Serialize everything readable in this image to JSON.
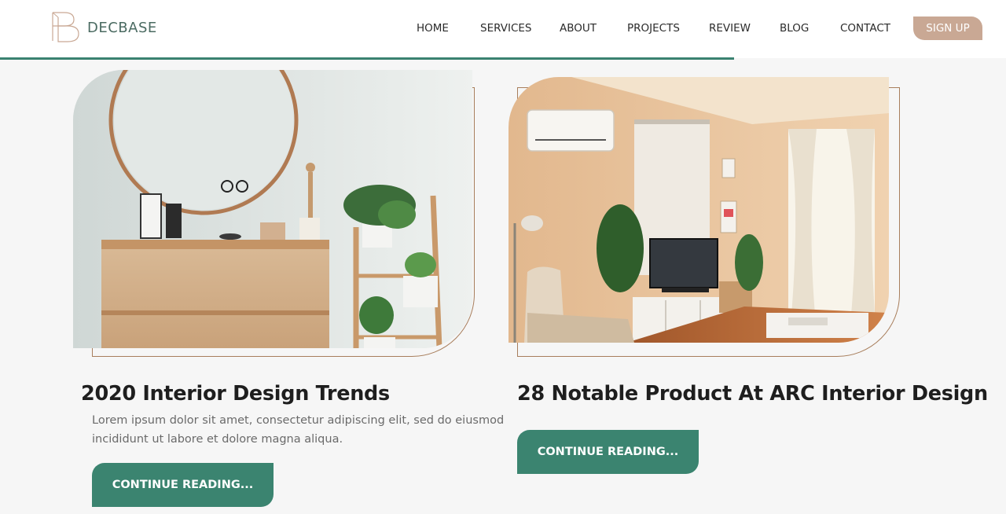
{
  "brand": {
    "name": "DECBASE"
  },
  "nav": {
    "items": [
      {
        "label": "HOME"
      },
      {
        "label": "SERVICES"
      },
      {
        "label": "ABOUT"
      },
      {
        "label": "PROJECTS"
      },
      {
        "label": "REVIEW"
      },
      {
        "label": "BLOG"
      },
      {
        "label": "CONTACT"
      }
    ],
    "signup_label": "SIGN UP"
  },
  "scroll_progress": 0.73,
  "posts": [
    {
      "title": "2020 Interior Design Trends",
      "excerpt": "Lorem ipsum dolor sit amet, consectetur adipiscing elit, sed do eiusmod incididunt ut labore et dolore magna aliqua.",
      "button_label": "CONTINUE READING...",
      "image_alt": "dresser-with-mirror-photo"
    },
    {
      "title": "28 Notable Product At ARC Interior Design",
      "excerpt": "",
      "button_label": "CONTINUE READING...",
      "image_alt": "living-room-photo"
    }
  ],
  "colors": {
    "accent_green": "#3b8470",
    "accent_tan": "#c9a894",
    "frame_brown": "#a87e5c"
  },
  "icons": {
    "logo": "decbase-logo-icon"
  }
}
